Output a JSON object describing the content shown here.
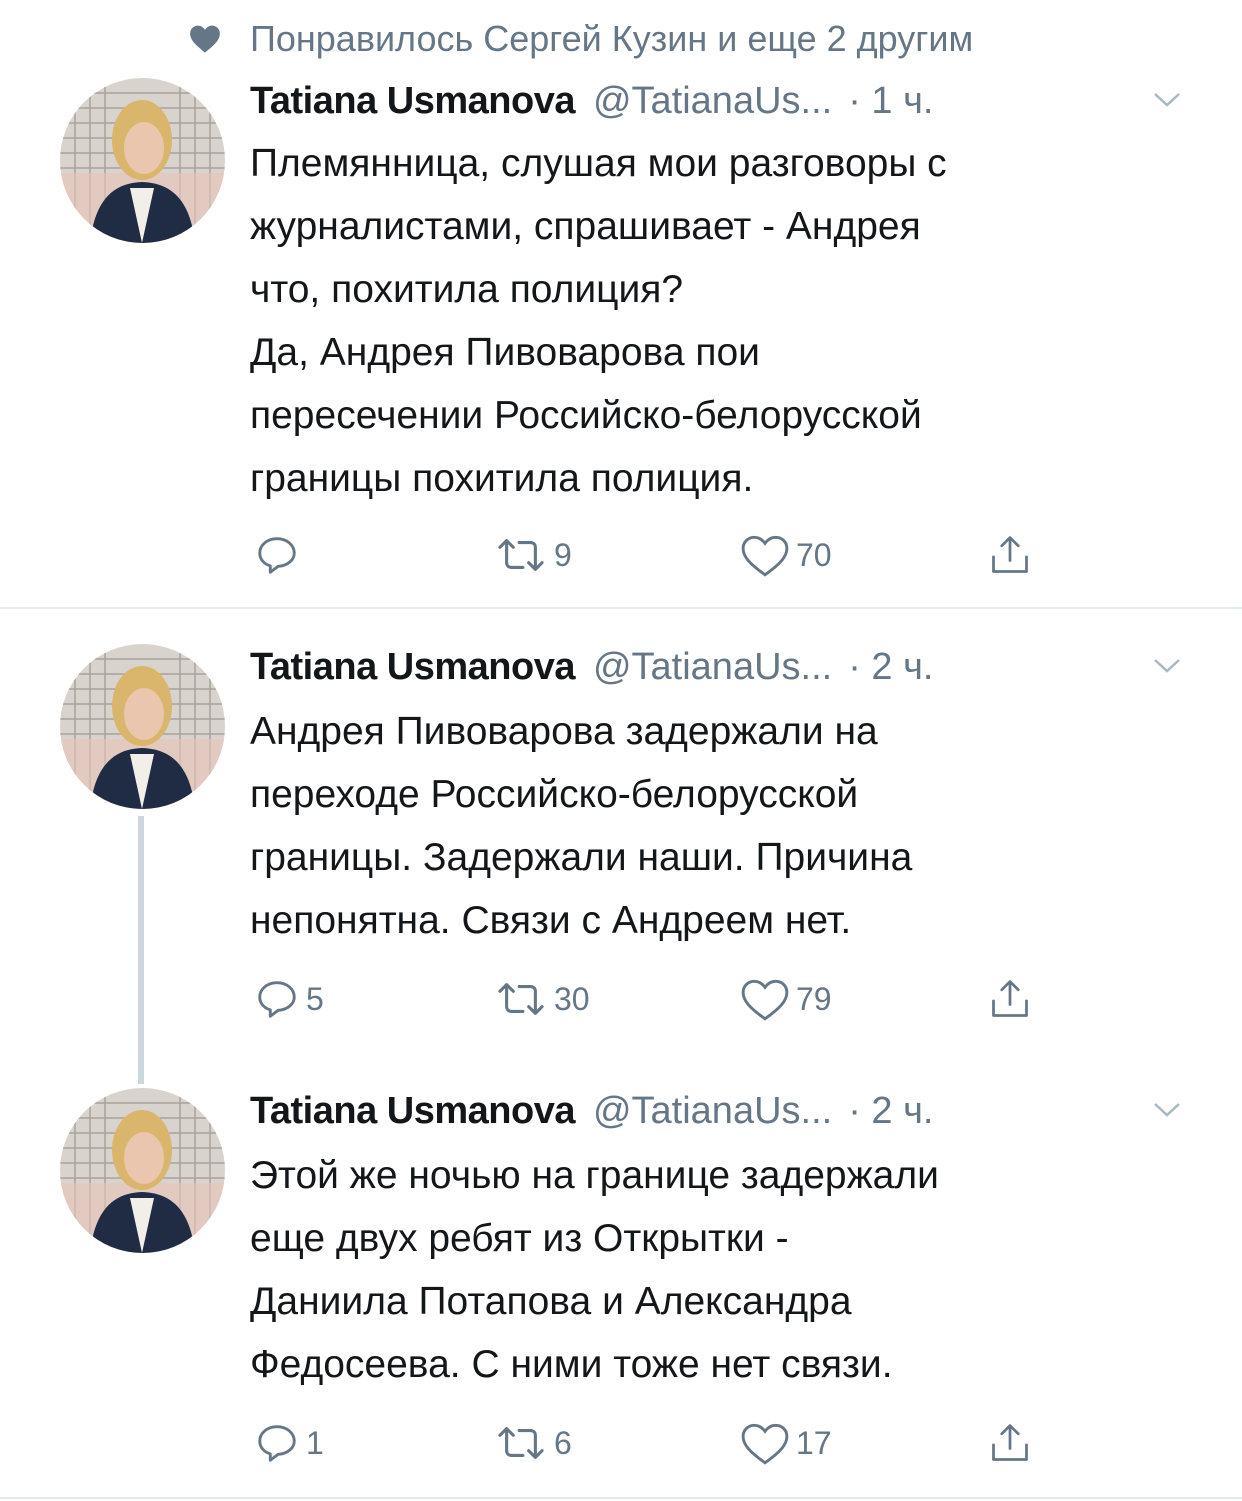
{
  "social_context": {
    "icon": "heart-filled-icon",
    "text": "Понравилось Сергей Кузин и еще 2 другим"
  },
  "tweets": [
    {
      "name": "Tatiana Usmanova",
      "handle": "@TatianaUs...",
      "time": "· 1 ч.",
      "text": "Племянница, слушая мои разговоры с\nжурналистами, спрашивает - Андрея\nчто, похитила полиция?\nДа, Андрея Пивоварова пои\nпересечении Российско-белорусской\nграницы похитила полиция.",
      "replies": "",
      "retweets": "9",
      "likes": "70"
    },
    {
      "name": "Tatiana Usmanova",
      "handle": "@TatianaUs...",
      "time": "· 2 ч.",
      "text": "Андрея Пивоварова задержали на\nпереходе Российско-белорусской\nграницы. Задержали наши. Причина\nнепонятна. Связи с Андреем нет.",
      "replies": "5",
      "retweets": "30",
      "likes": "79"
    },
    {
      "name": "Tatiana Usmanova",
      "handle": "@TatianaUs...",
      "time": "· 2 ч.",
      "text": "Этой же ночью на границе задержали\nеще двух ребят из Открытки -\nДаниила Потапова и Александра\nФедосеева. С ними тоже нет связи.",
      "replies": "1",
      "retweets": "6",
      "likes": "17"
    }
  ],
  "colors": {
    "text": "#14171a",
    "secondary": "#657786",
    "border": "#e1e8ed",
    "thread": "#ccd6dd"
  }
}
